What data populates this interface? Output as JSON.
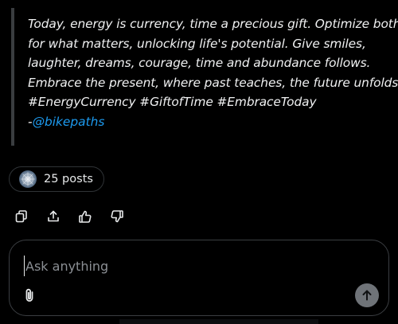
{
  "quote": {
    "lines": [
      "Today, energy is currency, time a precious gift. Optimize both",
      "for what matters, unlocking life's potential. Give smiles,",
      "laughter, dreams, courage, time and abundance follows.",
      "Embrace the present, where past teaches, the future unfolds.",
      "#EnergyCurrency #GiftofTime #EmbraceToday"
    ],
    "signature_prefix": "-",
    "signature_handle": "@bikepaths"
  },
  "posts_chip": {
    "label": "25 posts",
    "avatar_icon": "avatar-icon"
  },
  "actions": [
    {
      "icon": "copy-icon"
    },
    {
      "icon": "share-icon"
    },
    {
      "icon": "thumbs-up-icon"
    },
    {
      "icon": "thumbs-down-icon"
    }
  ],
  "composer": {
    "placeholder": "Ask anything",
    "attach_icon": "paperclip-icon",
    "send_icon": "arrow-up-icon"
  },
  "colors": {
    "background": "#000000",
    "text": "#e7e9ea",
    "link": "#1d9bf0",
    "border": "#2f3336",
    "send_button": "#6f7378"
  }
}
